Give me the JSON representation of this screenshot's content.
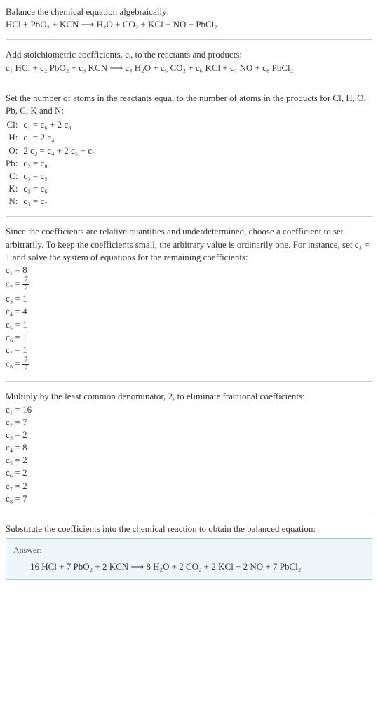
{
  "title": "Balance the chemical equation algebraically:",
  "eq_unbalanced": "HCl + PbO₂ + KCN  ⟶  H₂O + CO₂ + KCl + NO + PbCl₂",
  "stoich_intro": "Add stoichiometric coefficients, cᵢ, to the reactants and products:",
  "eq_stoich": "c₁ HCl + c₂ PbO₂ + c₃ KCN  ⟶  c₄ H₂O + c₅ CO₂ + c₆ KCl + c₇ NO + c₈ PbCl₂",
  "atoms_intro": "Set the number of atoms in the reactants equal to the number of atoms in the products for Cl, H, O, Pb, C, K and N:",
  "atom_rows": [
    {
      "el": "Cl:",
      "eq": "c₁ = c₆ + 2 c₈"
    },
    {
      "el": "H:",
      "eq": "c₁ = 2 c₄"
    },
    {
      "el": "O:",
      "eq": "2 c₂ = c₄ + 2 c₅ + c₇"
    },
    {
      "el": "Pb:",
      "eq": "c₂ = c₈"
    },
    {
      "el": "C:",
      "eq": "c₃ = c₅"
    },
    {
      "el": "K:",
      "eq": "c₃ = c₆"
    },
    {
      "el": "N:",
      "eq": "c₃ = c₇"
    }
  ],
  "underdet": "Since the coefficients are relative quantities and underdetermined, choose a coefficient to set arbitrarily. To keep the coefficients small, the arbitrary value is ordinarily one. For instance, set c₃ = 1 and solve the system of equations for the remaining coefficients:",
  "coef1": {
    "c1": "c₁ = 8",
    "c2_label": "c₂ = ",
    "c2_num": "7",
    "c2_den": "2",
    "c3": "c₃ = 1",
    "c4": "c₄ = 4",
    "c5": "c₅ = 1",
    "c6": "c₆ = 1",
    "c7": "c₇ = 1",
    "c8_label": "c₈ = ",
    "c8_num": "7",
    "c8_den": "2"
  },
  "lcd_intro": "Multiply by the least common denominator, 2, to eliminate fractional coefficients:",
  "coef2": [
    "c₁ = 16",
    "c₂ = 7",
    "c₃ = 2",
    "c₄ = 8",
    "c₅ = 2",
    "c₆ = 2",
    "c₇ = 2",
    "c₈ = 7"
  ],
  "subst_intro": "Substitute the coefficients into the chemical reaction to obtain the balanced equation:",
  "answer_label": "Answer:",
  "answer_eq": "16 HCl + 7 PbO₂ + 2 KCN  ⟶  8 H₂O + 2 CO₂ + 2 KCl + 2 NO + 7 PbCl₂"
}
